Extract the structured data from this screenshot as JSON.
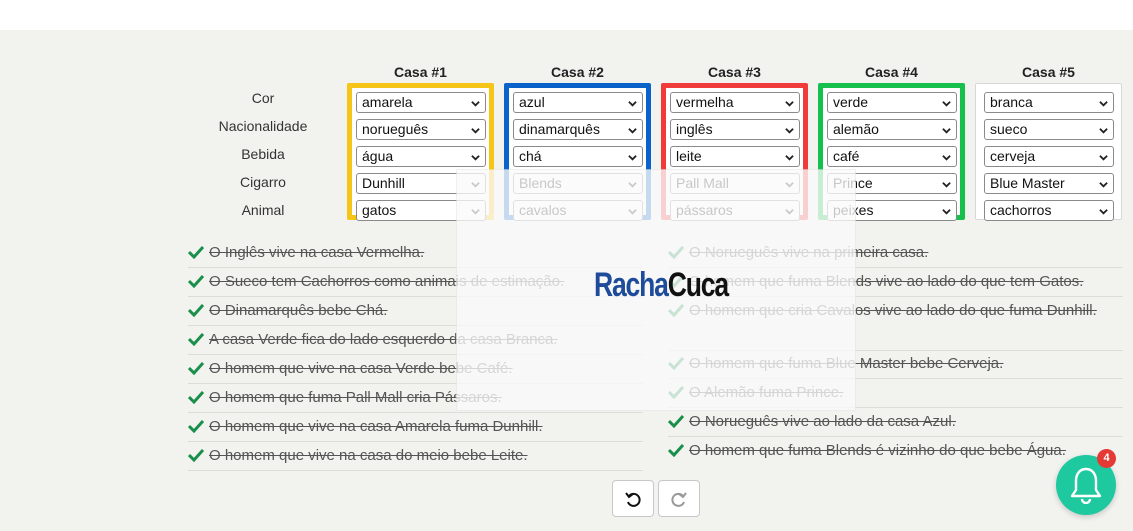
{
  "row_labels": [
    "Cor",
    "Nacionalidade",
    "Bebida",
    "Cigarro",
    "Animal"
  ],
  "houses": [
    {
      "title": "Casa #1",
      "color": "#f5c518",
      "values": [
        "amarela",
        "norueguês",
        "água",
        "Dunhill",
        "gatos"
      ]
    },
    {
      "title": "Casa #2",
      "color": "#0a63c9",
      "values": [
        "azul",
        "dinamarquês",
        "chá",
        "Blends",
        "cavalos"
      ]
    },
    {
      "title": "Casa #3",
      "color": "#f03b3b",
      "values": [
        "vermelha",
        "inglês",
        "leite",
        "Pall Mall",
        "pássaros"
      ]
    },
    {
      "title": "Casa #4",
      "color": "#16c04c",
      "values": [
        "verde",
        "alemão",
        "café",
        "Prince",
        "peixes"
      ]
    },
    {
      "title": "Casa #5",
      "color": "#d8d8d8",
      "values": [
        "branca",
        "sueco",
        "cerveja",
        "Blue Master",
        "cachorros"
      ]
    }
  ],
  "clues_left": [
    "O Inglês vive na casa Vermelha.",
    "O Sueco tem Cachorros como animais de estimação.",
    "O Dinamarquês bebe Chá.",
    "A casa Verde fica do lado esquerdo da casa Branca.",
    "O homem que vive na casa Verde bebe Café.",
    "O homem que fuma Pall Mall cria Pássaros.",
    "O homem que vive na casa Amarela fuma Dunhill.",
    "O homem que vive na casa do meio bebe Leite."
  ],
  "clues_right": [
    "O Norueguês vive na primeira casa.",
    "O homem que fuma Blends vive ao lado do que tem Gatos.",
    "O homem que cria Cavalos vive ao lado do que fuma Dunhill.",
    "O homem que fuma Blue Master bebe Cerveja.",
    "O Alemão fuma Prince.",
    "O Norueguês vive ao lado da casa Azul.",
    "O homem que fuma Blends é vizinho do que bebe Água."
  ],
  "logo": {
    "part1": "Racha",
    "part2": "Cuca"
  },
  "toolbar": {
    "undo_icon": "undo-icon",
    "redo_icon": "redo-icon"
  },
  "notifications": {
    "count": "4",
    "icon": "bell-icon"
  },
  "colors": {
    "check": "#1a8f4a",
    "bell_bg": "#1fc9a0",
    "badge_bg": "#e53935"
  }
}
